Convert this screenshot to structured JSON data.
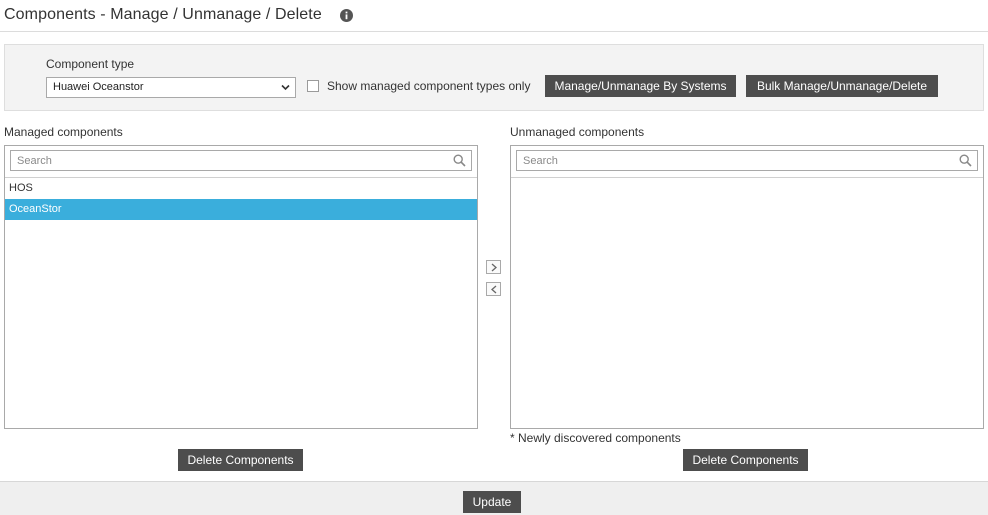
{
  "header": {
    "title": "Components - Manage / Unmanage / Delete",
    "info_icon": "info-icon"
  },
  "filter": {
    "component_type_label": "Component type",
    "component_type_value": "Huawei Oceanstor",
    "show_managed_only_label": "Show managed component types only",
    "show_managed_only_checked": false,
    "manage_by_systems_button": "Manage/Unmanage By Systems",
    "bulk_button": "Bulk Manage/Unmanage/Delete"
  },
  "managed": {
    "label": "Managed components",
    "search_placeholder": "Search",
    "items": [
      {
        "label": "HOS",
        "selected": false
      },
      {
        "label": "OceanStor",
        "selected": true
      }
    ],
    "delete_button": "Delete Components"
  },
  "transfer": {
    "move_right_icon": "chevron-right-icon",
    "move_left_icon": "chevron-left-icon"
  },
  "unmanaged": {
    "label": "Unmanaged components",
    "search_placeholder": "Search",
    "items": [],
    "footnote": "* Newly discovered components",
    "delete_button": "Delete Components"
  },
  "footer": {
    "update_button": "Update"
  },
  "colors": {
    "selected_row": "#3aaedc",
    "button_bg": "#4d4d4d",
    "panel_bg": "#f3f3f3"
  }
}
